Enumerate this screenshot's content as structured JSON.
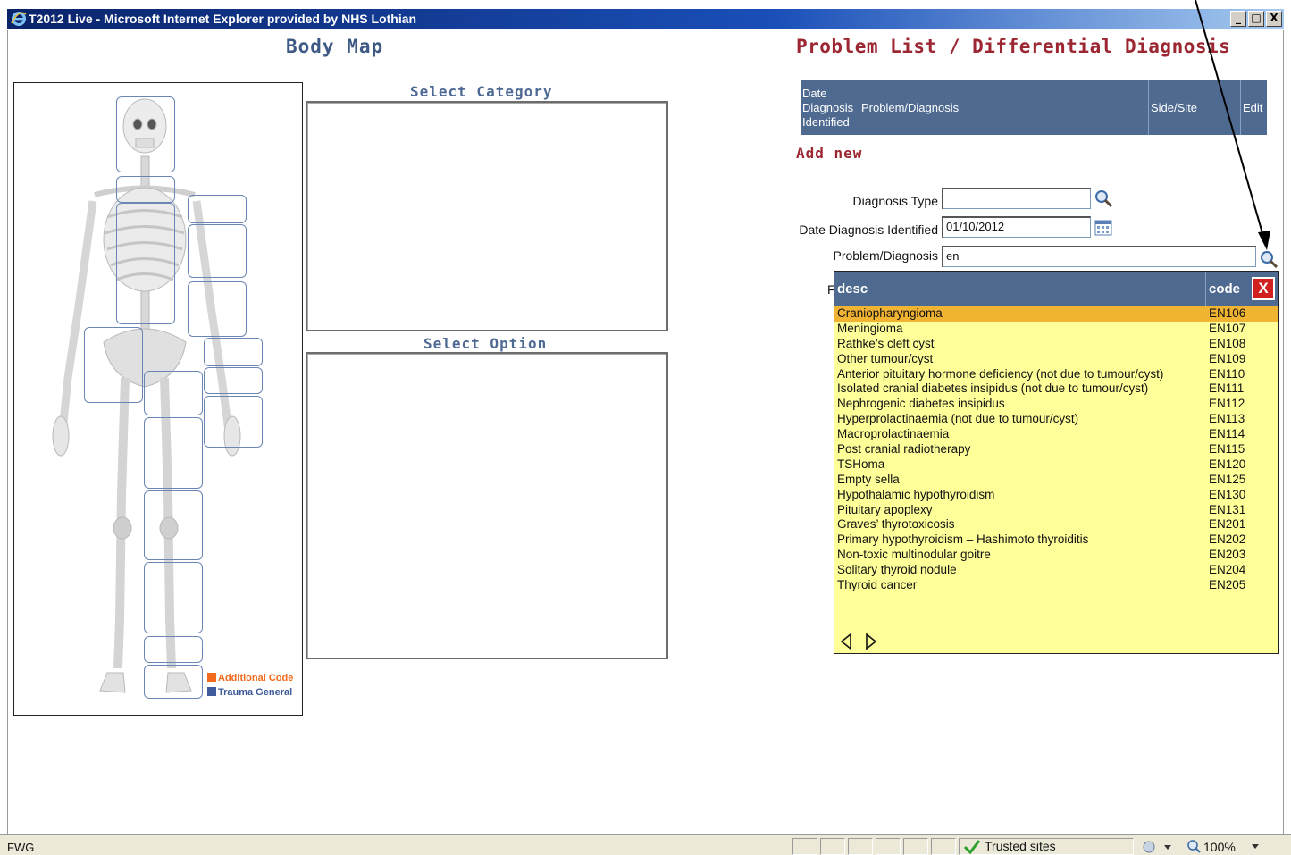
{
  "window": {
    "title": "T2012 Live - Microsoft Internet Explorer provided by NHS Lothian",
    "min_label": "_",
    "max_label": "□",
    "close_label": "X"
  },
  "body_map": {
    "title": "Body Map",
    "legend": [
      {
        "label": "Additional Code",
        "color": "#f26a1b"
      },
      {
        "label": "Trauma General",
        "color": "#3e5a9a"
      }
    ]
  },
  "select_category": {
    "title": "Select Category"
  },
  "select_option": {
    "title": "Select Option"
  },
  "problem_list": {
    "title": "Problem List / Differential Diagnosis",
    "columns": {
      "date_line1": "Date",
      "date_line2": "Diagnosis",
      "date_line3": "Identified",
      "problem": "Problem/Diagnosis",
      "side": "Side/Site",
      "edit": "Edit"
    },
    "add_new": "Add new"
  },
  "form": {
    "diagnosis_type_label": "Diagnosis Type",
    "diagnosis_type_value": "",
    "date_label": "Date Diagnosis Identified",
    "date_value": "01/10/2012",
    "problem_label": "Problem/Diagnosis",
    "problem_value": "en",
    "hidden_label_fragment": "F"
  },
  "dropdown": {
    "header_desc": "desc",
    "header_code": "code",
    "close_label": "X",
    "selected_index": 0,
    "rows": [
      {
        "desc": "Craniopharyngioma",
        "code": "EN106"
      },
      {
        "desc": "Meningioma",
        "code": "EN107"
      },
      {
        "desc": "Rathke’s cleft cyst",
        "code": "EN108"
      },
      {
        "desc": "Other tumour/cyst",
        "code": "EN109"
      },
      {
        "desc": "Anterior pituitary hormone deficiency (not due to tumour/cyst)",
        "code": "EN110"
      },
      {
        "desc": "Isolated cranial diabetes insipidus (not due to tumour/cyst)",
        "code": "EN111"
      },
      {
        "desc": "Nephrogenic diabetes insipidus",
        "code": "EN112"
      },
      {
        "desc": "Hyperprolactinaemia (not due to tumour/cyst)",
        "code": "EN113"
      },
      {
        "desc": "Macroprolactinaemia",
        "code": "EN114"
      },
      {
        "desc": "Post cranial radiotherapy",
        "code": "EN115"
      },
      {
        "desc": "TSHoma",
        "code": "EN120"
      },
      {
        "desc": "Empty sella",
        "code": "EN125"
      },
      {
        "desc": "Hypothalamic hypothyroidism",
        "code": "EN130"
      },
      {
        "desc": "Pituitary apoplexy",
        "code": "EN131"
      },
      {
        "desc": "Graves’ thyrotoxicosis",
        "code": "EN201"
      },
      {
        "desc": "Primary hypothyroidism – Hashimoto thyroiditis",
        "code": "EN202"
      },
      {
        "desc": "Non-toxic multinodular goitre",
        "code": "EN203"
      },
      {
        "desc": "Solitary thyroid nodule",
        "code": "EN204"
      },
      {
        "desc": "Thyroid cancer",
        "code": "EN205"
      }
    ]
  },
  "status_bar": {
    "left_text": "FWG",
    "zone": "Trusted sites",
    "zoom": "100%"
  },
  "colors": {
    "heading_blue": "#3e5a84",
    "heading_red": "#9c2732",
    "header_bg": "#4f6a90",
    "dropdown_bg": "#ffff99",
    "selected_row": "#f0b332"
  }
}
